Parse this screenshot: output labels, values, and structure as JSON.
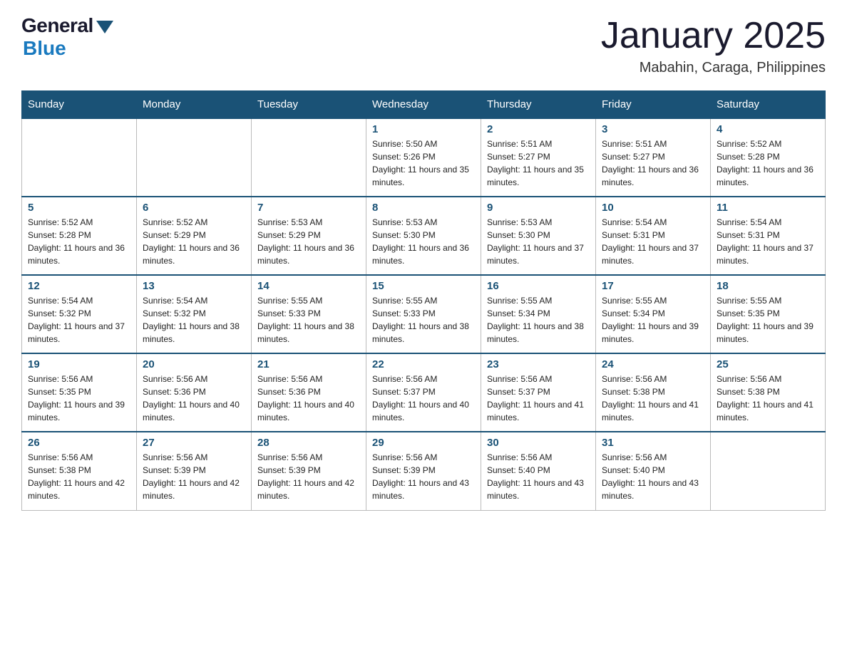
{
  "header": {
    "logo": {
      "general": "General",
      "blue": "Blue"
    },
    "title": "January 2025",
    "location": "Mabahin, Caraga, Philippines"
  },
  "weekdays": [
    "Sunday",
    "Monday",
    "Tuesday",
    "Wednesday",
    "Thursday",
    "Friday",
    "Saturday"
  ],
  "weeks": [
    [
      {
        "day": "",
        "info": ""
      },
      {
        "day": "",
        "info": ""
      },
      {
        "day": "",
        "info": ""
      },
      {
        "day": "1",
        "info": "Sunrise: 5:50 AM\nSunset: 5:26 PM\nDaylight: 11 hours and 35 minutes."
      },
      {
        "day": "2",
        "info": "Sunrise: 5:51 AM\nSunset: 5:27 PM\nDaylight: 11 hours and 35 minutes."
      },
      {
        "day": "3",
        "info": "Sunrise: 5:51 AM\nSunset: 5:27 PM\nDaylight: 11 hours and 36 minutes."
      },
      {
        "day": "4",
        "info": "Sunrise: 5:52 AM\nSunset: 5:28 PM\nDaylight: 11 hours and 36 minutes."
      }
    ],
    [
      {
        "day": "5",
        "info": "Sunrise: 5:52 AM\nSunset: 5:28 PM\nDaylight: 11 hours and 36 minutes."
      },
      {
        "day": "6",
        "info": "Sunrise: 5:52 AM\nSunset: 5:29 PM\nDaylight: 11 hours and 36 minutes."
      },
      {
        "day": "7",
        "info": "Sunrise: 5:53 AM\nSunset: 5:29 PM\nDaylight: 11 hours and 36 minutes."
      },
      {
        "day": "8",
        "info": "Sunrise: 5:53 AM\nSunset: 5:30 PM\nDaylight: 11 hours and 36 minutes."
      },
      {
        "day": "9",
        "info": "Sunrise: 5:53 AM\nSunset: 5:30 PM\nDaylight: 11 hours and 37 minutes."
      },
      {
        "day": "10",
        "info": "Sunrise: 5:54 AM\nSunset: 5:31 PM\nDaylight: 11 hours and 37 minutes."
      },
      {
        "day": "11",
        "info": "Sunrise: 5:54 AM\nSunset: 5:31 PM\nDaylight: 11 hours and 37 minutes."
      }
    ],
    [
      {
        "day": "12",
        "info": "Sunrise: 5:54 AM\nSunset: 5:32 PM\nDaylight: 11 hours and 37 minutes."
      },
      {
        "day": "13",
        "info": "Sunrise: 5:54 AM\nSunset: 5:32 PM\nDaylight: 11 hours and 38 minutes."
      },
      {
        "day": "14",
        "info": "Sunrise: 5:55 AM\nSunset: 5:33 PM\nDaylight: 11 hours and 38 minutes."
      },
      {
        "day": "15",
        "info": "Sunrise: 5:55 AM\nSunset: 5:33 PM\nDaylight: 11 hours and 38 minutes."
      },
      {
        "day": "16",
        "info": "Sunrise: 5:55 AM\nSunset: 5:34 PM\nDaylight: 11 hours and 38 minutes."
      },
      {
        "day": "17",
        "info": "Sunrise: 5:55 AM\nSunset: 5:34 PM\nDaylight: 11 hours and 39 minutes."
      },
      {
        "day": "18",
        "info": "Sunrise: 5:55 AM\nSunset: 5:35 PM\nDaylight: 11 hours and 39 minutes."
      }
    ],
    [
      {
        "day": "19",
        "info": "Sunrise: 5:56 AM\nSunset: 5:35 PM\nDaylight: 11 hours and 39 minutes."
      },
      {
        "day": "20",
        "info": "Sunrise: 5:56 AM\nSunset: 5:36 PM\nDaylight: 11 hours and 40 minutes."
      },
      {
        "day": "21",
        "info": "Sunrise: 5:56 AM\nSunset: 5:36 PM\nDaylight: 11 hours and 40 minutes."
      },
      {
        "day": "22",
        "info": "Sunrise: 5:56 AM\nSunset: 5:37 PM\nDaylight: 11 hours and 40 minutes."
      },
      {
        "day": "23",
        "info": "Sunrise: 5:56 AM\nSunset: 5:37 PM\nDaylight: 11 hours and 41 minutes."
      },
      {
        "day": "24",
        "info": "Sunrise: 5:56 AM\nSunset: 5:38 PM\nDaylight: 11 hours and 41 minutes."
      },
      {
        "day": "25",
        "info": "Sunrise: 5:56 AM\nSunset: 5:38 PM\nDaylight: 11 hours and 41 minutes."
      }
    ],
    [
      {
        "day": "26",
        "info": "Sunrise: 5:56 AM\nSunset: 5:38 PM\nDaylight: 11 hours and 42 minutes."
      },
      {
        "day": "27",
        "info": "Sunrise: 5:56 AM\nSunset: 5:39 PM\nDaylight: 11 hours and 42 minutes."
      },
      {
        "day": "28",
        "info": "Sunrise: 5:56 AM\nSunset: 5:39 PM\nDaylight: 11 hours and 42 minutes."
      },
      {
        "day": "29",
        "info": "Sunrise: 5:56 AM\nSunset: 5:39 PM\nDaylight: 11 hours and 43 minutes."
      },
      {
        "day": "30",
        "info": "Sunrise: 5:56 AM\nSunset: 5:40 PM\nDaylight: 11 hours and 43 minutes."
      },
      {
        "day": "31",
        "info": "Sunrise: 5:56 AM\nSunset: 5:40 PM\nDaylight: 11 hours and 43 minutes."
      },
      {
        "day": "",
        "info": ""
      }
    ]
  ]
}
